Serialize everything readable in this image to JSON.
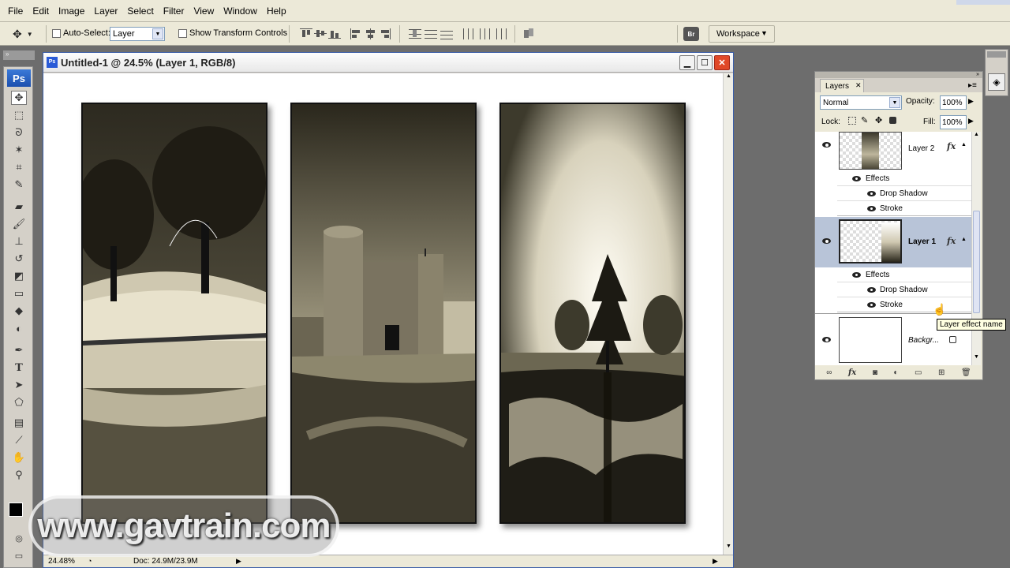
{
  "menu": [
    "File",
    "Edit",
    "Image",
    "Layer",
    "Select",
    "Filter",
    "View",
    "Window",
    "Help"
  ],
  "options": {
    "auto_select_label": "Auto-Select:",
    "auto_select_value": "Layer",
    "show_transform_label": "Show Transform Controls",
    "workspace_label": "Workspace"
  },
  "tools_badge": "Ps",
  "document": {
    "title": "Untitled-1 @ 24.5% (Layer 1, RGB/8)",
    "zoom": "24.48%",
    "doc_size": "Doc: 24.9M/23.9M"
  },
  "layers_panel": {
    "tab": "Layers",
    "blend_mode": "Normal",
    "opacity_label": "Opacity:",
    "opacity_value": "100%",
    "lock_label": "Lock:",
    "fill_label": "Fill:",
    "fill_value": "100%",
    "layers": [
      {
        "name": "Layer 2",
        "effects_label": "Effects",
        "effects": [
          "Drop Shadow",
          "Stroke"
        ]
      },
      {
        "name": "Layer 1",
        "effects_label": "Effects",
        "effects": [
          "Drop Shadow",
          "Stroke"
        ]
      },
      {
        "name": "Backgr..."
      }
    ],
    "tooltip": "Layer effect name"
  },
  "watermark": "www.gavtrain.com",
  "colors": {
    "accent_blue": "#2a5bd7",
    "selected_layer": "#b8c4d8"
  },
  "icons": [
    "move-tool-icon",
    "marquee-icon",
    "lasso-icon",
    "magic-wand-icon",
    "crop-icon",
    "slice-icon",
    "healing-icon",
    "brush-icon",
    "stamp-icon",
    "history-brush-icon",
    "eraser-icon",
    "gradient-icon",
    "blur-icon",
    "dodge-icon",
    "pen-icon",
    "type-icon",
    "path-select-icon",
    "shape-icon",
    "notes-icon",
    "eyedropper-icon",
    "hand-icon",
    "zoom-icon",
    "eye-icon",
    "fx-icon",
    "lock-icon",
    "link-icon",
    "trash-icon"
  ]
}
